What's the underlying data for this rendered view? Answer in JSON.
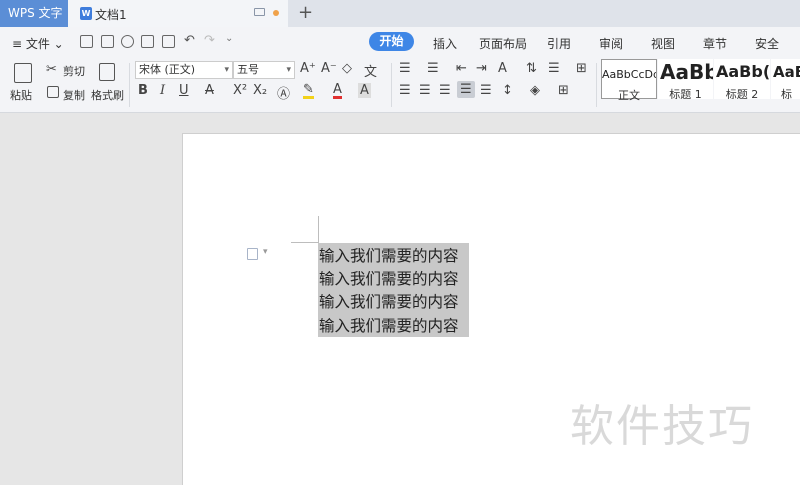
{
  "titlebar": {
    "app_tab": "WPS 文字",
    "doc_tab": "文档1",
    "new_tab": "+"
  },
  "menubar": {
    "file_label": "≡ 文件 ⌄",
    "tabs": [
      "开始",
      "插入",
      "页面布局",
      "引用",
      "审阅",
      "视图",
      "章节",
      "安全"
    ],
    "active_tab": "开始"
  },
  "toolbar": {
    "paste": "粘贴",
    "cut": "剪切",
    "copy": "复制",
    "format_painter": "格式刷",
    "font_name": "宋体 (正文)",
    "font_size": "五号",
    "bold": "B",
    "italic": "I",
    "underline": "U",
    "superscript": "X²",
    "subscript": "X₂",
    "font_color_a": "A",
    "styles": [
      {
        "preview": "AaBbCcDd",
        "name": "正文"
      },
      {
        "preview": "AaBb",
        "name": "标题 1"
      },
      {
        "preview": "AaBb(",
        "name": "标题 2"
      },
      {
        "preview": "AaB",
        "name": "标题"
      }
    ]
  },
  "document": {
    "lines": [
      "输入我们需要的内容",
      "输入我们需要的内容",
      "输入我们需要的内容",
      "输入我们需要的内容"
    ],
    "watermark": "软件技巧"
  },
  "colors": {
    "accent": "#3e86e6",
    "wps_tab": "#5b8ed6",
    "selection": "#c8c8c8"
  }
}
